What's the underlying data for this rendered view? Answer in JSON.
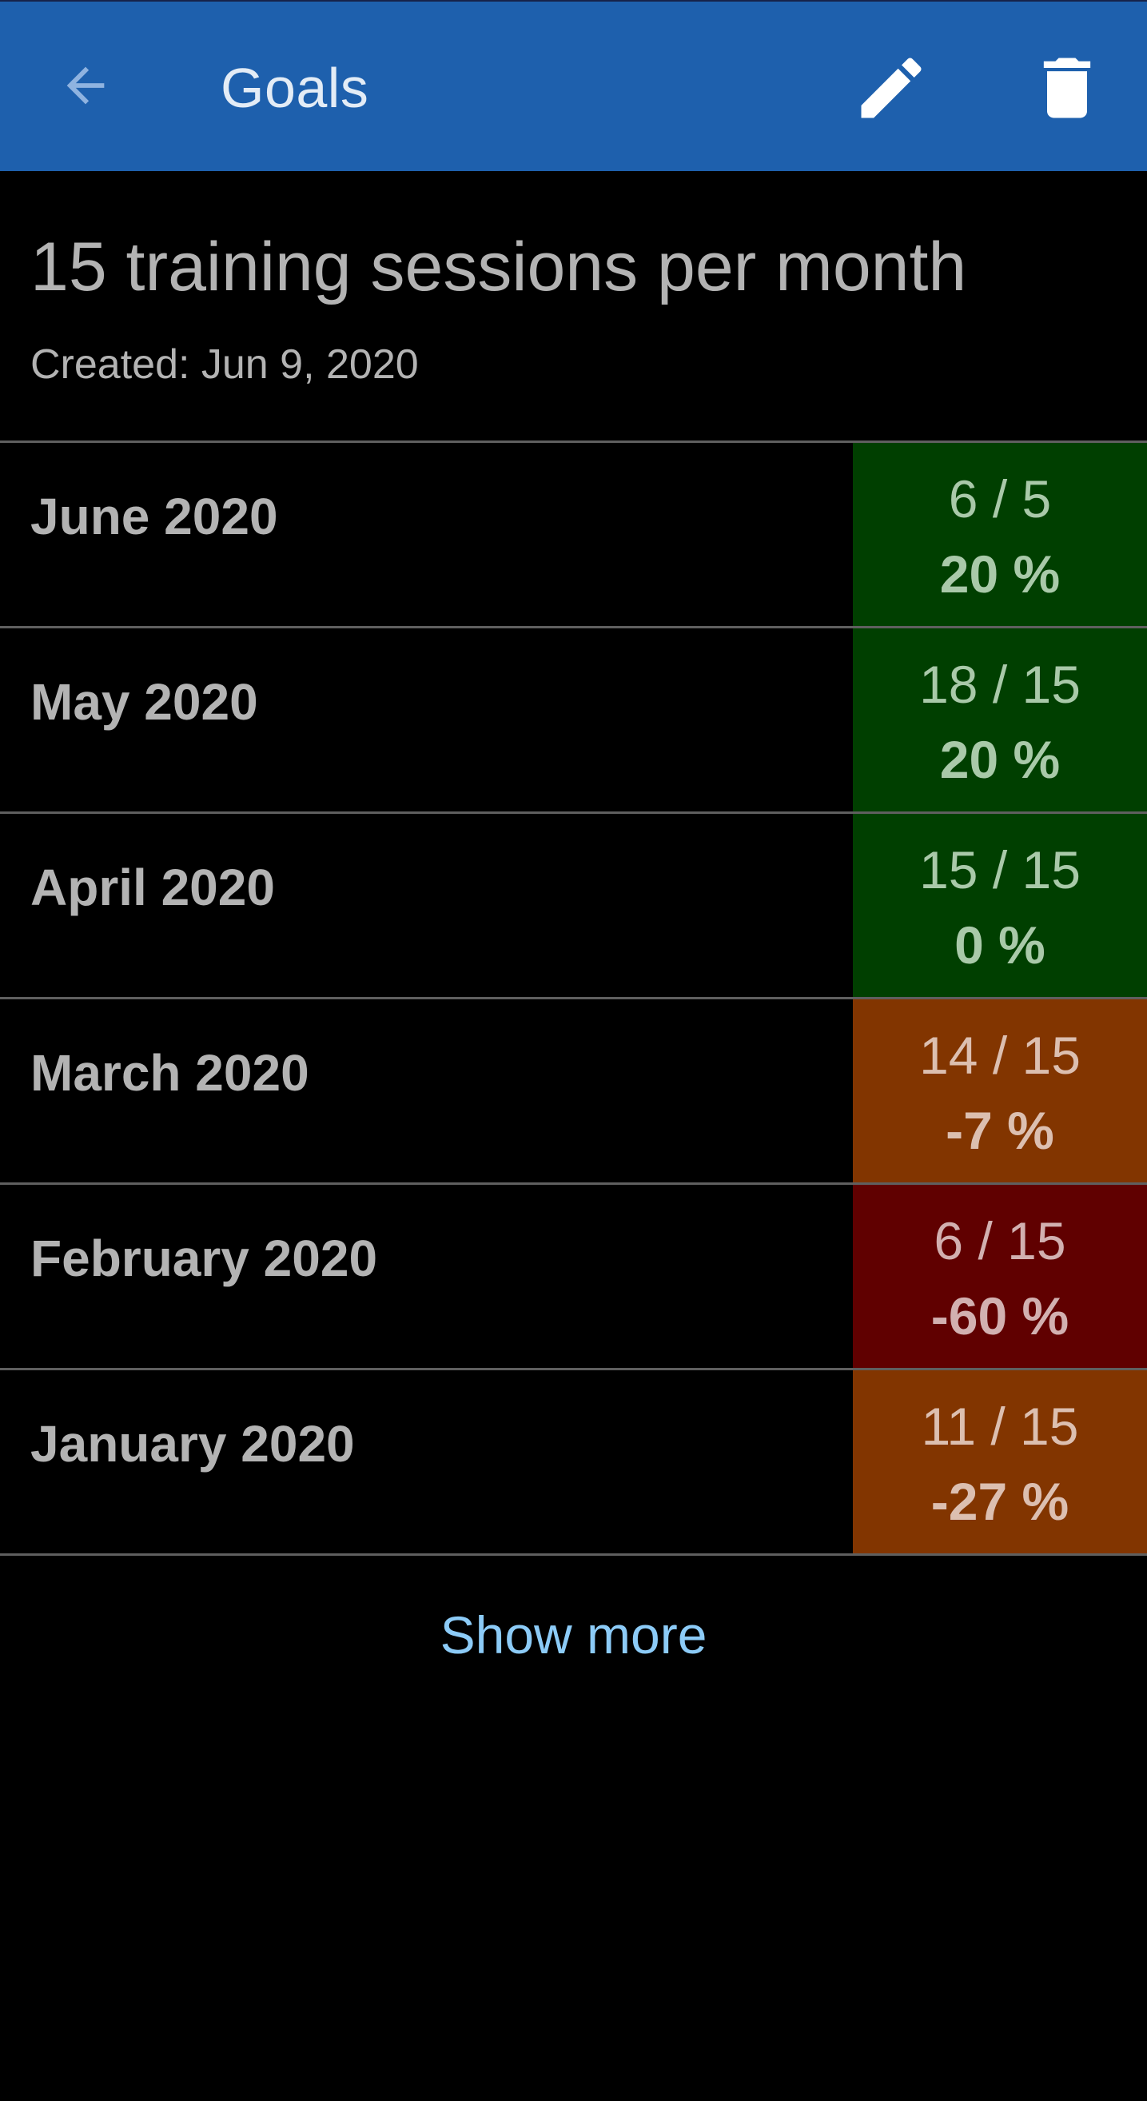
{
  "app_bar": {
    "title": "Goals",
    "back_icon": "arrow-left-icon",
    "edit_icon": "pencil-icon",
    "delete_icon": "trash-icon",
    "background_color": "#1e60ad"
  },
  "goal": {
    "title": "15 training sessions per month",
    "created": "Created: Jun 9, 2020"
  },
  "periods": [
    {
      "label": "June 2020",
      "count": "6 / 5",
      "percent": "20 %",
      "status": "exceeded",
      "bg": "#003f00",
      "fg": "#a9c9a9"
    },
    {
      "label": "May 2020",
      "count": "18 / 15",
      "percent": "20 %",
      "status": "exceeded",
      "bg": "#003f00",
      "fg": "#a9c9a9"
    },
    {
      "label": "April 2020",
      "count": "15 / 15",
      "percent": "0 %",
      "status": "met",
      "bg": "#003f00",
      "fg": "#a9c9a9"
    },
    {
      "label": "March 2020",
      "count": "14 / 15",
      "percent": "-7 %",
      "status": "slightly-below",
      "bg": "#823500",
      "fg": "#dcbfb0"
    },
    {
      "label": "February 2020",
      "count": "6 / 15",
      "percent": "-60 %",
      "status": "far-below",
      "bg": "#600000",
      "fg": "#d2b0b0"
    },
    {
      "label": "January 2020",
      "count": "11 / 15",
      "percent": "-27 %",
      "status": "below",
      "bg": "#823500",
      "fg": "#dcbfb0"
    }
  ],
  "show_more": {
    "label": "Show more",
    "color": "#8ccbf7"
  }
}
